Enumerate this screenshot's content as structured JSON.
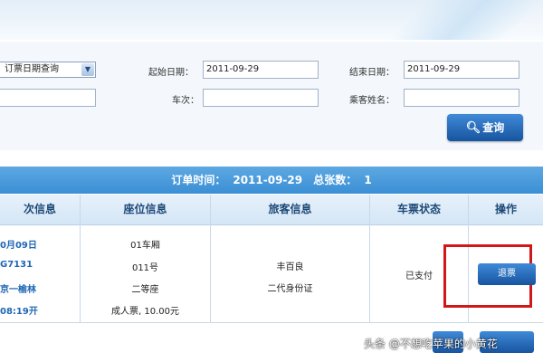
{
  "search": {
    "date_type_select": "订票日期查询",
    "start_date_label": "起始日期：",
    "start_date_value": "2011-09-29",
    "end_date_label": "结束日期：",
    "end_date_value": "2011-09-29",
    "train_label": "车次：",
    "train_value": "",
    "passenger_label": "乘客姓名：",
    "passenger_value": "",
    "query_button": "查询"
  },
  "order_bar": {
    "time_label": "订单时间：",
    "time_value": "2011-09-29",
    "count_label": "总张数：",
    "count_value": "1"
  },
  "table": {
    "headers": [
      "次信息",
      "座位信息",
      "旅客信息",
      "车票状态",
      "操作"
    ],
    "row": {
      "train_info": [
        "0月09日",
        "G7131",
        "京一榆林",
        "08:19开"
      ],
      "seat_info": [
        "01车厢",
        "011号",
        "二等座",
        "成人票, 10.00元"
      ],
      "passenger_info": [
        "丰百良",
        "二代身份证"
      ],
      "status": "已支付",
      "action": "退票"
    }
  },
  "watermark": "头条 @不想吃苹果的小黄花",
  "colors": {
    "accent_blue": "#17549f",
    "header_bar": "#4a9bdc",
    "highlight_red": "#d01818"
  }
}
